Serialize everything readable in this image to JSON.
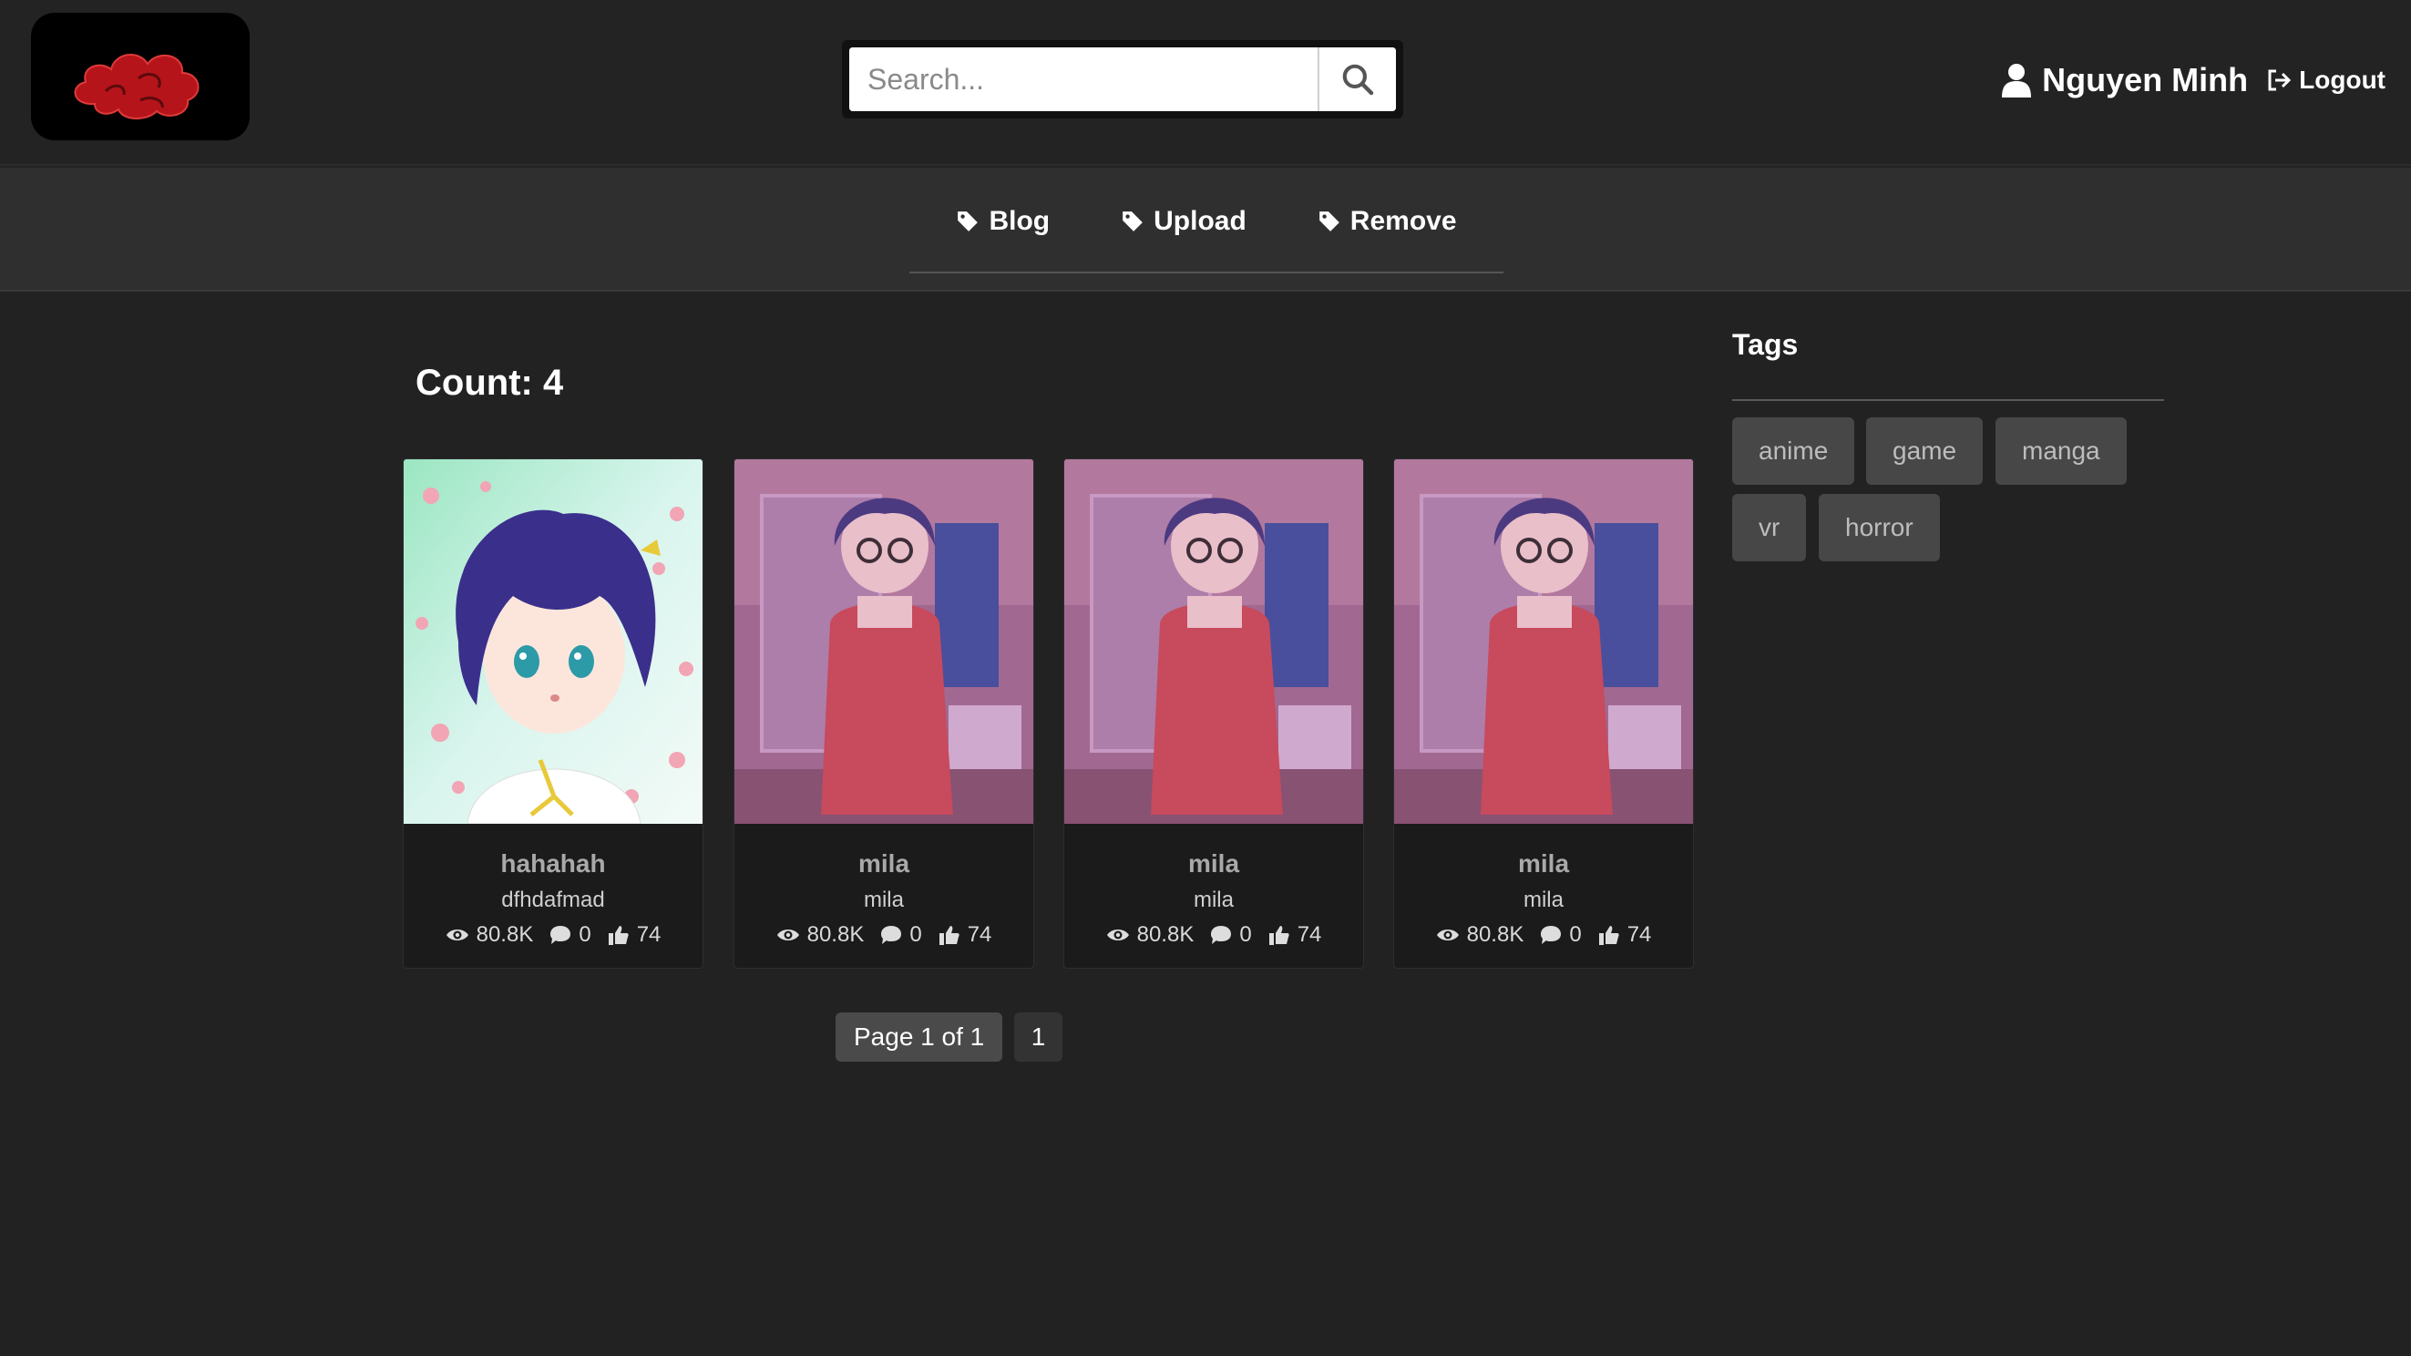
{
  "header": {
    "search_placeholder": "Search...",
    "user_name": "Nguyen Minh",
    "logout_label": "Logout"
  },
  "nav": {
    "items": [
      {
        "label": "Blog",
        "icon": "tag-icon"
      },
      {
        "label": "Upload",
        "icon": "tag-icon"
      },
      {
        "label": "Remove",
        "icon": "tag-icon"
      }
    ]
  },
  "main": {
    "count_label": "Count: 4",
    "cards": [
      {
        "title": "hahahah",
        "subtitle": "dfhdafmad",
        "views": "80.8K",
        "comments": "0",
        "likes": "74",
        "image": "anime-girl-sakura"
      },
      {
        "title": "mila",
        "subtitle": "mila",
        "views": "80.8K",
        "comments": "0",
        "likes": "74",
        "image": "anime-girl-room"
      },
      {
        "title": "mila",
        "subtitle": "mila",
        "views": "80.8K",
        "comments": "0",
        "likes": "74",
        "image": "anime-girl-room"
      },
      {
        "title": "mila",
        "subtitle": "mila",
        "views": "80.8K",
        "comments": "0",
        "likes": "74",
        "image": "anime-girl-room"
      }
    ]
  },
  "pagination": {
    "info": "Page 1 of 1",
    "current": "1"
  },
  "sidebar": {
    "title": "Tags",
    "tags": [
      "anime",
      "game",
      "manga",
      "vr",
      "horror"
    ]
  },
  "colors": {
    "background": "#222222",
    "nav_background": "#2f2f2f",
    "logo_cloud": "#c0161b",
    "tag_background": "#474747"
  }
}
